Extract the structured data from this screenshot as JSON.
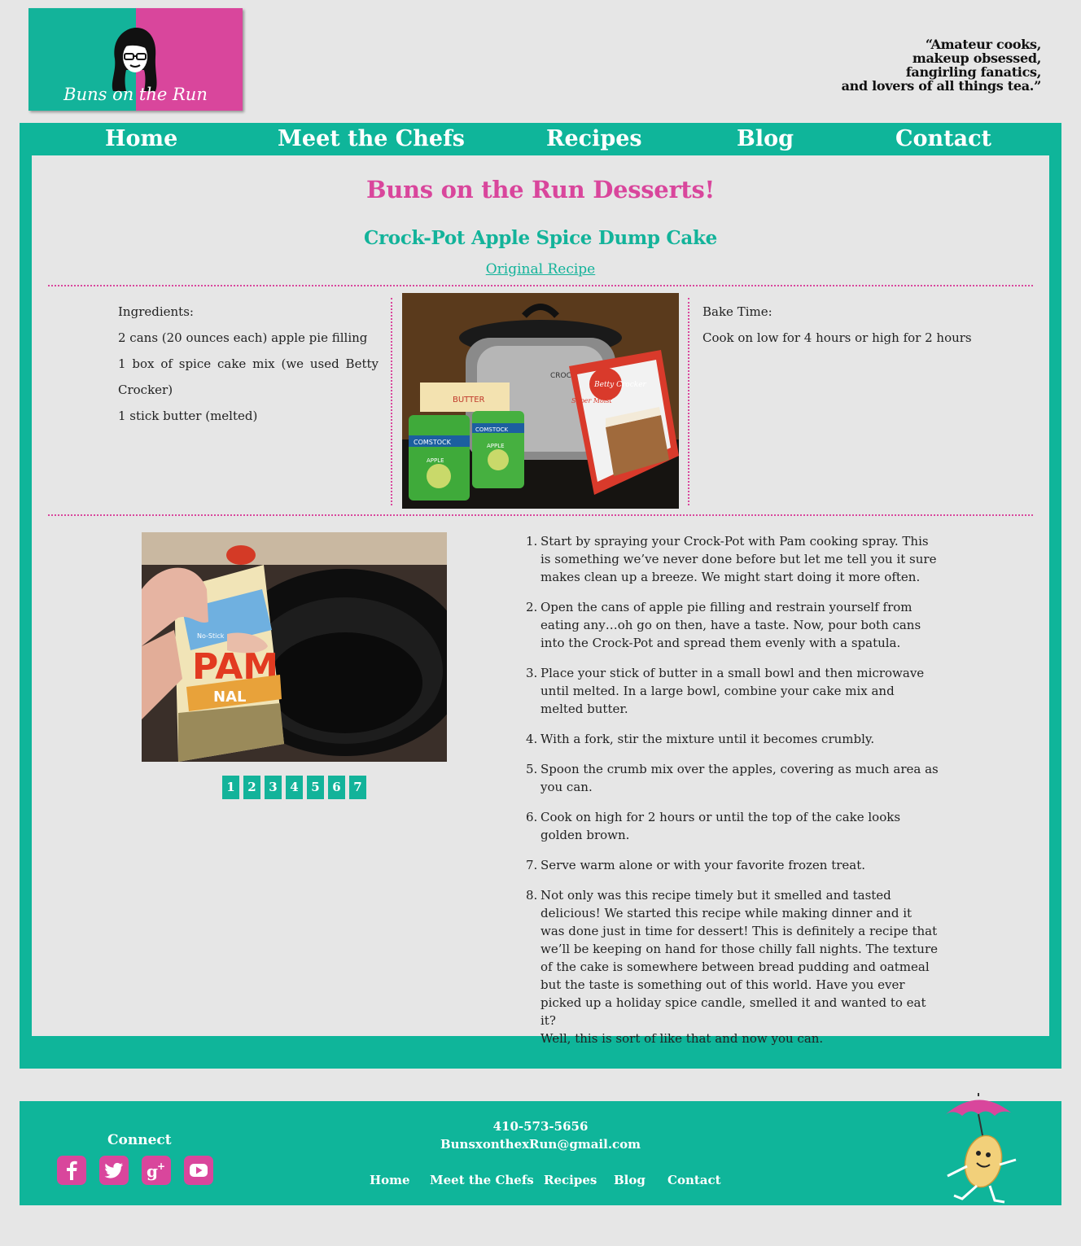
{
  "header": {
    "logo_text": "Buns on the Run",
    "tagline": [
      "“Amateur cooks,",
      "makeup obsessed,",
      "fangirling fanatics,",
      "and lovers of all things tea.”"
    ]
  },
  "nav": {
    "items": [
      "Home",
      "Meet the Chefs",
      "Recipes",
      "Blog",
      "Contact"
    ]
  },
  "page": {
    "title": "Buns on the Run Desserts!",
    "recipe_title": "Crock-Pot Apple Spice Dump Cake",
    "original_link": "Original Recipe"
  },
  "ingredients": {
    "heading": "Ingredients:",
    "items": [
      "2 cans (20 ounces each) apple pie filling",
      "1 box of spice cake mix (we used Betty Crocker)",
      "1 stick butter (melted)"
    ]
  },
  "photo_labels": {
    "crockpot": "CROCK-POT",
    "butter": "BUTTER",
    "cake_mix_brand": "Betty Crocker",
    "cake_mix_line": "Super Moist",
    "can_brand": "COMSTOCK",
    "can_flavor": "APPLE",
    "spray_brand": "PAM",
    "spray_sub": "No-Stick",
    "spray_type": "NAL"
  },
  "bake": {
    "heading": "Bake Time:",
    "text": "Cook on low for 4 hours or high for 2 hours"
  },
  "slideshow": {
    "pages": [
      "1",
      "2",
      "3",
      "4",
      "5",
      "6",
      "7"
    ]
  },
  "steps": [
    {
      "num": "1.",
      "text": "Start by spraying your Crock-Pot with Pam cooking spray. This is something we’ve never done before but let me tell you it sure makes clean up a breeze. We might start doing it more often."
    },
    {
      "num": "2.",
      "text": "Open the cans of apple pie filling and restrain yourself from eating any…oh go on then, have a taste. Now, pour both cans into the Crock-Pot and spread them evenly with a spatula."
    },
    {
      "num": "3.",
      "text": "Place your stick of butter in a small bowl and then microwave until melted. In a large bowl, combine your cake mix and melted butter."
    },
    {
      "num": "4.",
      "text": "With a fork, stir the mixture until it becomes crumbly."
    },
    {
      "num": "5.",
      "text": "Spoon the crumb mix over the apples, covering as much area as you can."
    },
    {
      "num": "6.",
      "text": "Cook on high for 2 hours or until the top of the cake looks golden brown."
    },
    {
      "num": "7.",
      "text": "Serve warm alone or with your favorite frozen treat."
    },
    {
      "num": "8.",
      "text": "Not only was this recipe timely but it smelled and tasted delicious! We started this recipe while making dinner and it was done just in time for dessert! This is definitely a recipe that we’ll be keeping on hand for those chilly fall nights. The texture of the cake is somewhere between bread pudding and oatmeal but the taste is something out of this world. Have you ever picked up a holiday spice candle, smelled it and wanted to eat it?",
      "extra": "Well, this is sort of like that and now you can."
    }
  ],
  "footer": {
    "connect": "Connect",
    "social": [
      "facebook-icon",
      "twitter-icon",
      "google-plus-icon",
      "youtube-icon"
    ],
    "phone": "410-573-5656",
    "email": "BunsxonthexRun@gmail.com",
    "nav": [
      "Home",
      "Meet the Chefs",
      "Recipes",
      "Blog",
      "Contact"
    ]
  },
  "colors": {
    "teal": "#0fb59a",
    "pink": "#d9469c",
    "background": "#e6e6e6"
  }
}
